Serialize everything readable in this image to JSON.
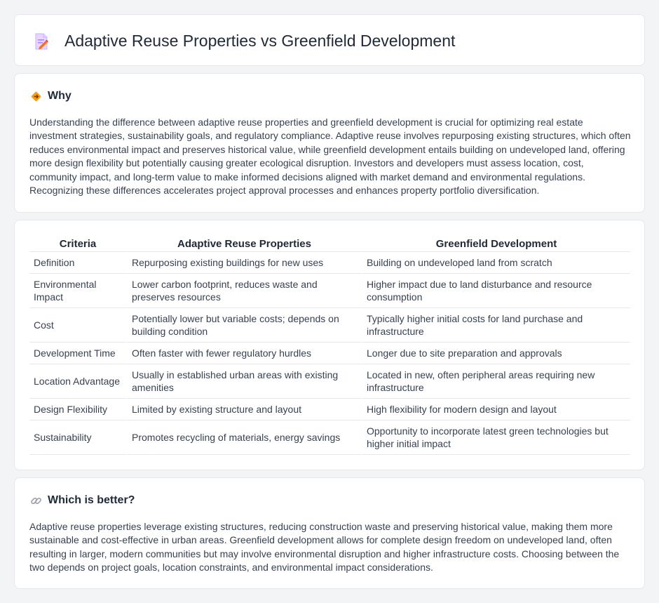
{
  "header": {
    "title": "Adaptive Reuse Properties vs Greenfield Development",
    "icon": "document-pencil-icon"
  },
  "why": {
    "title": "Why",
    "icon": "diamond-signal-icon",
    "text": "Understanding the difference between adaptive reuse properties and greenfield development is crucial for optimizing real estate investment strategies, sustainability goals, and regulatory compliance. Adaptive reuse involves repurposing existing structures, which often reduces environmental impact and preserves historical value, while greenfield development entails building on undeveloped land, offering more design flexibility but potentially causing greater ecological disruption. Investors and developers must assess location, cost, community impact, and long-term value to make informed decisions aligned with market demand and environmental regulations. Recognizing these differences accelerates project approval processes and enhances property portfolio diversification."
  },
  "comparison": {
    "headers": [
      "Criteria",
      "Adaptive Reuse Properties",
      "Greenfield Development"
    ],
    "rows": [
      [
        "Definition",
        "Repurposing existing buildings for new uses",
        "Building on undeveloped land from scratch"
      ],
      [
        "Environmental Impact",
        "Lower carbon footprint, reduces waste and preserves resources",
        "Higher impact due to land disturbance and resource consumption"
      ],
      [
        "Cost",
        "Potentially lower but variable costs; depends on building condition",
        "Typically higher initial costs for land purchase and infrastructure"
      ],
      [
        "Development Time",
        "Often faster with fewer regulatory hurdles",
        "Longer due to site preparation and approvals"
      ],
      [
        "Location Advantage",
        "Usually in established urban areas with existing amenities",
        "Located in new, often peripheral areas requiring new infrastructure"
      ],
      [
        "Design Flexibility",
        "Limited by existing structure and layout",
        "High flexibility for modern design and layout"
      ],
      [
        "Sustainability",
        "Promotes recycling of materials, energy savings",
        "Opportunity to incorporate latest green technologies but higher initial impact"
      ]
    ]
  },
  "better": {
    "title": "Which is better?",
    "icon": "link-icon",
    "text": "Adaptive reuse properties leverage existing structures, reducing construction waste and preserving historical value, making them more sustainable and cost-effective in urban areas. Greenfield development allows for complete design freedom on undeveloped land, often resulting in larger, modern communities but may involve environmental disruption and higher infrastructure costs. Choosing between the two depends on project goals, location constraints, and environmental impact considerations."
  },
  "colors": {
    "background": "#f3f4f6",
    "card": "#ffffff",
    "border": "#e5e7eb",
    "text": "#374151",
    "heading": "#1f2937",
    "accent_orange": "#f59e0b"
  }
}
